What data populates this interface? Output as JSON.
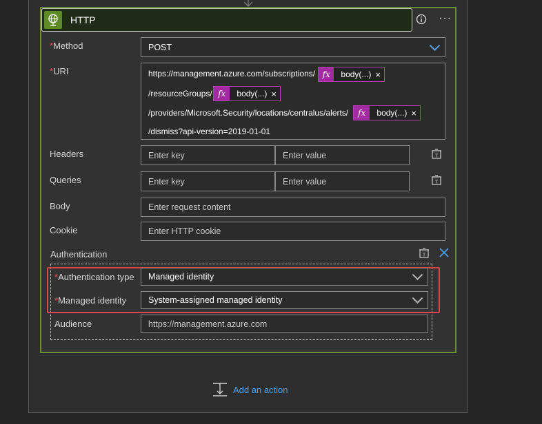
{
  "card": {
    "title": "HTTP",
    "icon": "globe-icon",
    "info_icon": "info-icon",
    "more_label": "···"
  },
  "required_mark": "*",
  "method": {
    "label": "Method",
    "value": "POST"
  },
  "uri": {
    "label": "URI",
    "lines": [
      "https://management.azure.com/subscriptions/",
      "/resourceGroups/",
      "/providers/Microsoft.Security/locations/centralus/alerts/",
      "/dismiss?api-version=2019-01-01"
    ],
    "tokens": [
      {
        "fx": "fx",
        "label": "body(...)",
        "remove": "×"
      },
      {
        "fx": "fx",
        "label": "body(...)",
        "remove": "×"
      },
      {
        "fx": "fx",
        "label": "body(...)",
        "remove": "×"
      }
    ]
  },
  "headers": {
    "label": "Headers",
    "key_placeholder": "Enter key",
    "value_placeholder": "Enter value"
  },
  "queries": {
    "label": "Queries",
    "key_placeholder": "Enter key",
    "value_placeholder": "Enter value"
  },
  "body": {
    "label": "Body",
    "placeholder": "Enter request content"
  },
  "cookie": {
    "label": "Cookie",
    "placeholder": "Enter HTTP cookie"
  },
  "authentication": {
    "label": "Authentication",
    "type_label": "Authentication type",
    "type_value": "Managed identity",
    "identity_label": "Managed identity",
    "identity_value": "System-assigned managed identity",
    "audience_label": "Audience",
    "audience_value": "https://management.azure.com"
  },
  "add_action": {
    "label": "Add an action",
    "icon": "add-action-icon"
  },
  "colors": {
    "accent": "#4aa3f0",
    "required": "#e8565c",
    "highlight": "#e0474c",
    "card_border": "#6b8f2f",
    "token": "#a32aa1"
  }
}
